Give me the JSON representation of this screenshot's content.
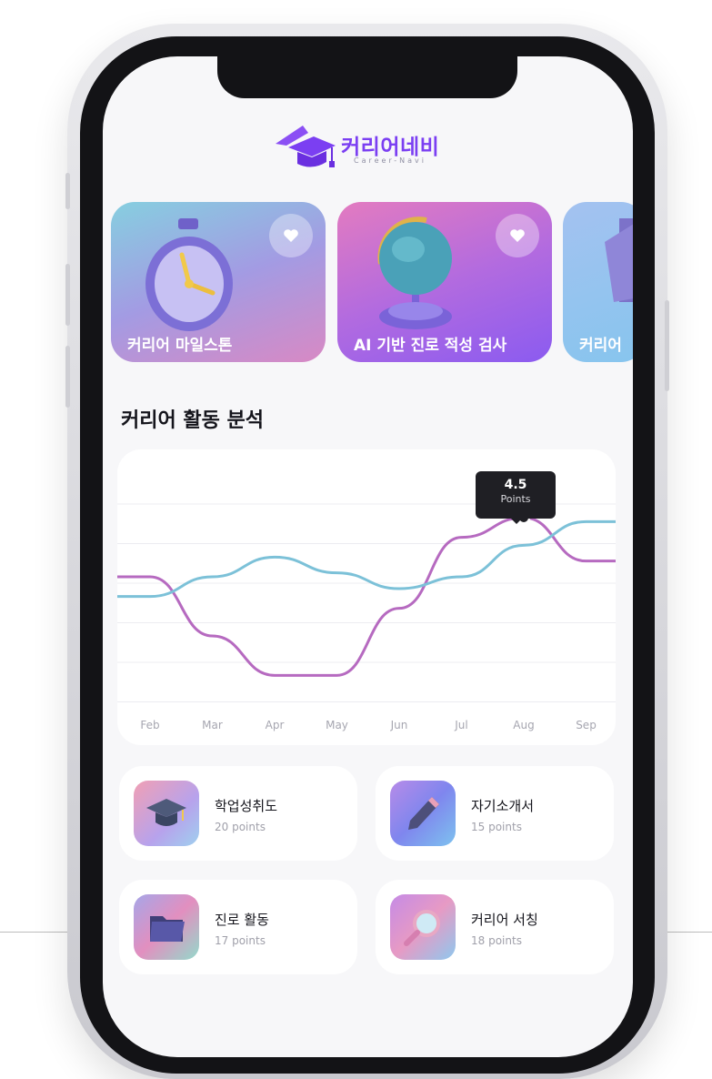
{
  "app": {
    "title": "커리어네비",
    "subtitle": "Career-Navi"
  },
  "featured_cards": [
    {
      "label": "커리어 마일스톤",
      "icon": "stopwatch-icon"
    },
    {
      "label": "AI 기반 진로 적성 검사",
      "icon": "globe-icon"
    },
    {
      "label": "커리어",
      "icon": "books-icon"
    }
  ],
  "analysis": {
    "section_title": "커리어 활동 분석",
    "tooltip_value": "4.5",
    "tooltip_unit": "Points"
  },
  "chart_data": {
    "type": "line",
    "categories": [
      "Feb",
      "Mar",
      "Apr",
      "May",
      "Jun",
      "Jul",
      "Aug",
      "Sep"
    ],
    "series": [
      {
        "color": "#b66ac0",
        "values": [
          3.0,
          1.5,
          0.5,
          0.5,
          2.2,
          4.0,
          4.5,
          3.4
        ]
      },
      {
        "color": "#7cc1d8",
        "values": [
          2.5,
          3.0,
          3.5,
          3.1,
          2.7,
          3.0,
          3.8,
          4.4
        ]
      }
    ],
    "highlight": {
      "category": "Aug",
      "value": 4.5,
      "label": "4.5",
      "unit": "Points"
    },
    "ylim": [
      0,
      6
    ],
    "grid": true
  },
  "stats": [
    {
      "title": "학업성취도",
      "points": "20 points",
      "icon": "graduation-cap-icon"
    },
    {
      "title": "자기소개서",
      "points": "15 points",
      "icon": "pencil-icon"
    },
    {
      "title": "진로 활동",
      "points": "17 points",
      "icon": "folder-icon"
    },
    {
      "title": "커리어 서칭",
      "points": "18 points",
      "icon": "magnifier-icon"
    }
  ],
  "colors": {
    "brand": "#7b3ff2",
    "series_purple": "#b66ac0",
    "series_blue": "#7cc1d8"
  }
}
